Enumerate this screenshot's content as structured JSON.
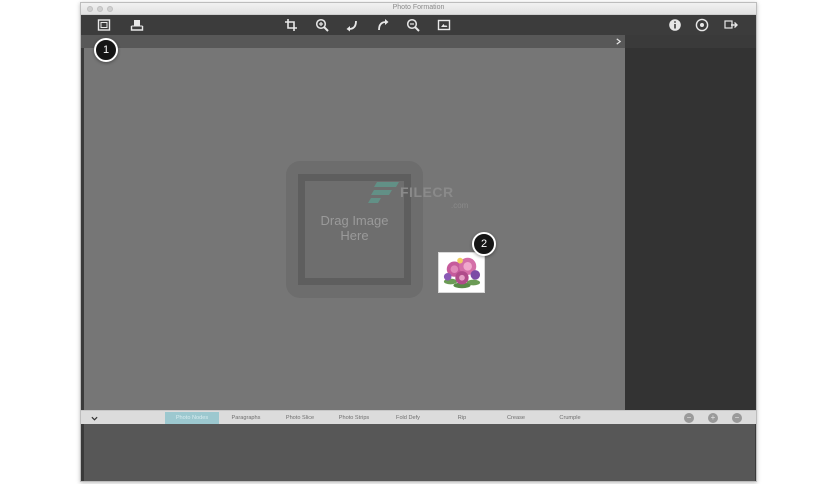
{
  "window": {
    "title": "Photo Formation"
  },
  "toolbar": {
    "left_icons": [
      "photo-frame-icon",
      "import-tray-icon"
    ],
    "center_icons": [
      "crop-icon",
      "zoom-in-icon",
      "rotate-left-icon",
      "rotate-right-icon",
      "zoom-out-icon",
      "fit-screen-icon"
    ],
    "right_icons": [
      "info-icon",
      "settings-icon",
      "share-icon"
    ]
  },
  "canvas": {
    "drop_text": "Drag Image\nHere",
    "watermark": {
      "name": "FILECR",
      "suffix": ".com"
    }
  },
  "callouts": {
    "first": "1",
    "second": "2"
  },
  "tabs": [
    {
      "label": "Photo Nodes",
      "active": true
    },
    {
      "label": "Paragraphs",
      "active": false
    },
    {
      "label": "Photo Slice",
      "active": false
    },
    {
      "label": "Photo Strips",
      "active": false
    },
    {
      "label": "Fold Defy",
      "active": false
    },
    {
      "label": "Rip",
      "active": false
    },
    {
      "label": "Crease",
      "active": false
    },
    {
      "label": "Crumple",
      "active": false
    }
  ],
  "tab_buttons": {
    "minus": "−",
    "plus": "+",
    "remove": "−"
  },
  "colors": {
    "accent_tab": "#9cc8cf",
    "canvas": "#767676",
    "sidebar": "#333333",
    "toolbar": "#3c3c3c"
  }
}
